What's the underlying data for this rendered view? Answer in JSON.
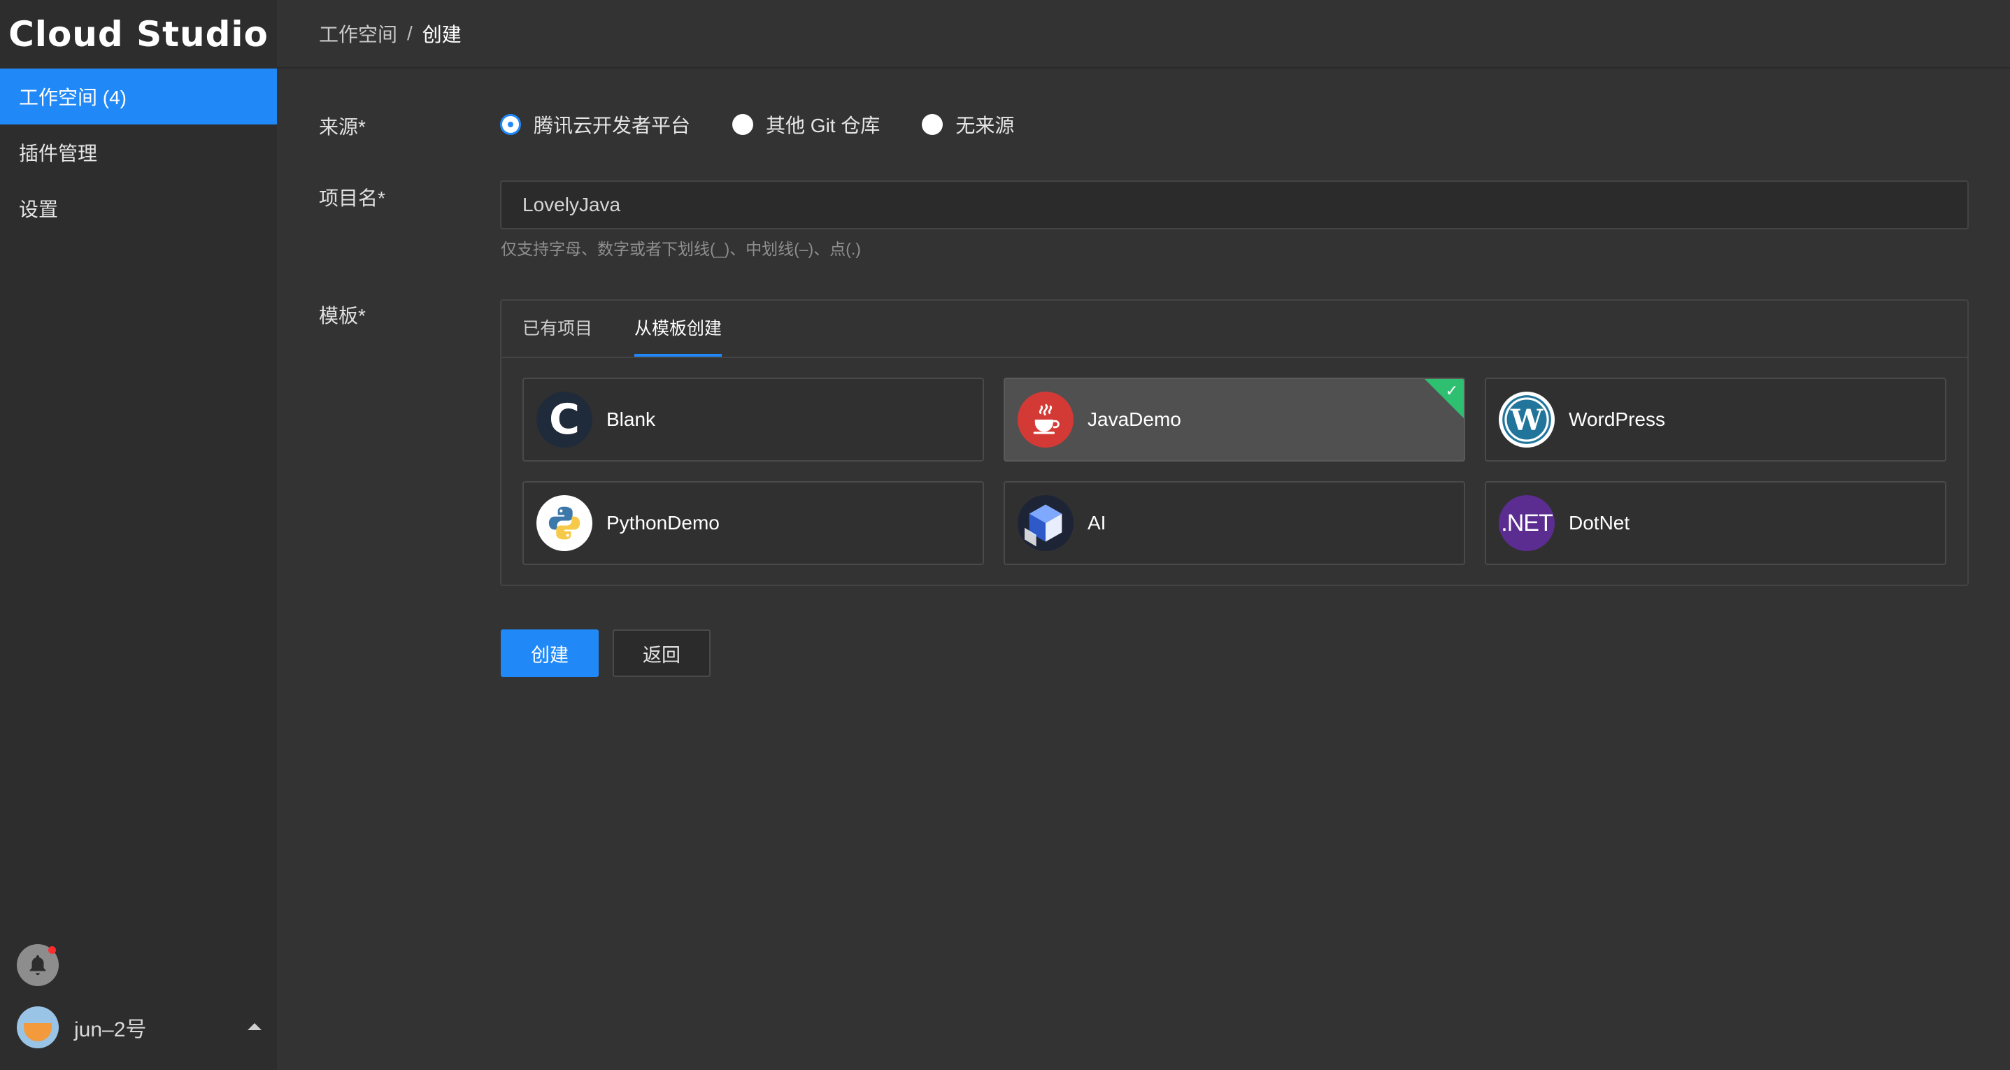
{
  "app": {
    "title": "Cloud Studio"
  },
  "sidebar": {
    "items": [
      {
        "label": "工作空间 (4)",
        "active": true
      },
      {
        "label": "插件管理",
        "active": false
      },
      {
        "label": "设置",
        "active": false
      }
    ],
    "user": {
      "name": "jun–2号"
    }
  },
  "breadcrumb": {
    "parent": "工作空间",
    "separator": "/",
    "current": "创建"
  },
  "form": {
    "source": {
      "label": "来源*",
      "options": [
        {
          "label": "腾讯云开发者平台",
          "checked": true
        },
        {
          "label": "其他 Git 仓库",
          "checked": false
        },
        {
          "label": "无来源",
          "checked": false
        }
      ]
    },
    "project": {
      "label": "项目名*",
      "value": "LovelyJava",
      "hint": "仅支持字母、数字或者下划线(_)、中划线(–)、点(.)"
    },
    "template": {
      "label": "模板*",
      "tabs": [
        {
          "label": "已有项目",
          "active": false
        },
        {
          "label": "从模板创建",
          "active": true
        }
      ],
      "cards": [
        {
          "name": "Blank",
          "icon": "blank-c-icon",
          "selected": false
        },
        {
          "name": "JavaDemo",
          "icon": "java-icon",
          "selected": true
        },
        {
          "name": "WordPress",
          "icon": "wordpress-icon",
          "selected": false
        },
        {
          "name": "PythonDemo",
          "icon": "python-icon",
          "selected": false
        },
        {
          "name": "AI",
          "icon": "ai-cube-icon",
          "selected": false
        },
        {
          "name": "DotNet",
          "icon": "dotnet-icon",
          "icon_text": ".NET",
          "selected": false
        }
      ]
    },
    "buttons": {
      "create": "创建",
      "back": "返回"
    }
  },
  "colors": {
    "accent": "#2189f7",
    "selected_badge": "#2fbf71",
    "java": "#d43a35",
    "wordpress": "#21759b",
    "dotnet": "#5b2d90"
  }
}
